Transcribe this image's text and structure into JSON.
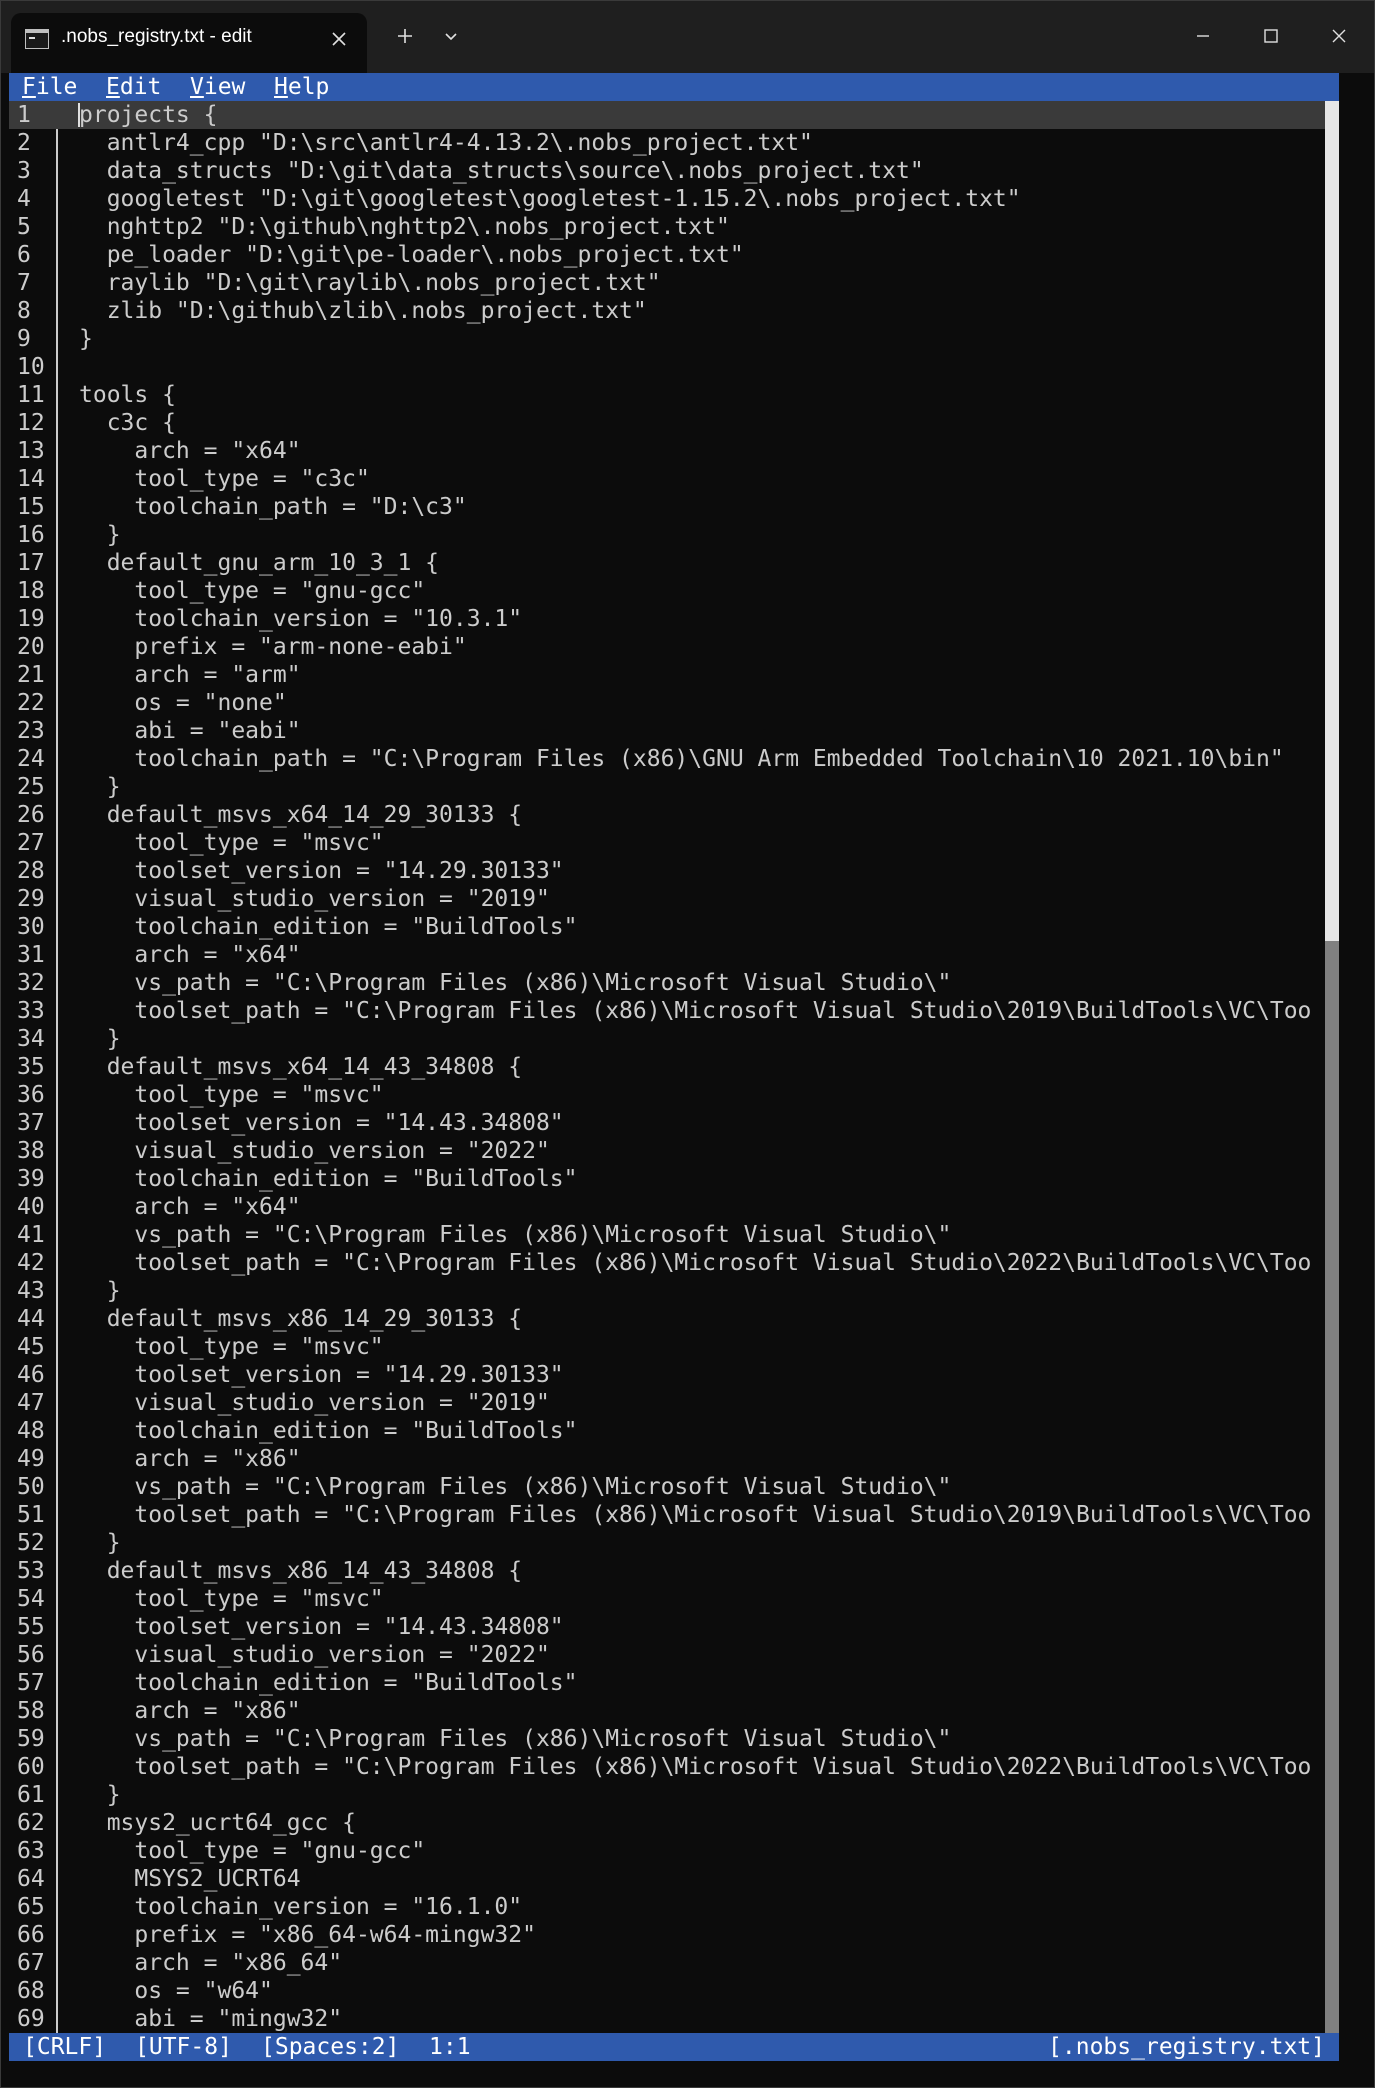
{
  "tab": {
    "title": ".nobs_registry.txt - edit"
  },
  "menu": {
    "file": "File",
    "edit": "Edit",
    "view": "View",
    "help": "Help"
  },
  "editor": {
    "current_line": 1,
    "lines": [
      "projects {",
      "  antlr4_cpp \"D:\\src\\antlr4-4.13.2\\.nobs_project.txt\"",
      "  data_structs \"D:\\git\\data_structs\\source\\.nobs_project.txt\"",
      "  googletest \"D:\\git\\googletest\\googletest-1.15.2\\.nobs_project.txt\"",
      "  nghttp2 \"D:\\github\\nghttp2\\.nobs_project.txt\"",
      "  pe_loader \"D:\\git\\pe-loader\\.nobs_project.txt\"",
      "  raylib \"D:\\git\\raylib\\.nobs_project.txt\"",
      "  zlib \"D:\\github\\zlib\\.nobs_project.txt\"",
      "}",
      "",
      "tools {",
      "  c3c {",
      "    arch = \"x64\"",
      "    tool_type = \"c3c\"",
      "    toolchain_path = \"D:\\c3\"",
      "  }",
      "  default_gnu_arm_10_3_1 {",
      "    tool_type = \"gnu-gcc\"",
      "    toolchain_version = \"10.3.1\"",
      "    prefix = \"arm-none-eabi\"",
      "    arch = \"arm\"",
      "    os = \"none\"",
      "    abi = \"eabi\"",
      "    toolchain_path = \"C:\\Program Files (x86)\\GNU Arm Embedded Toolchain\\10 2021.10\\bin\"",
      "  }",
      "  default_msvs_x64_14_29_30133 {",
      "    tool_type = \"msvc\"",
      "    toolset_version = \"14.29.30133\"",
      "    visual_studio_version = \"2019\"",
      "    toolchain_edition = \"BuildTools\"",
      "    arch = \"x64\"",
      "    vs_path = \"C:\\Program Files (x86)\\Microsoft Visual Studio\\\"",
      "    toolset_path = \"C:\\Program Files (x86)\\Microsoft Visual Studio\\2019\\BuildTools\\VC\\Too",
      "  }",
      "  default_msvs_x64_14_43_34808 {",
      "    tool_type = \"msvc\"",
      "    toolset_version = \"14.43.34808\"",
      "    visual_studio_version = \"2022\"",
      "    toolchain_edition = \"BuildTools\"",
      "    arch = \"x64\"",
      "    vs_path = \"C:\\Program Files (x86)\\Microsoft Visual Studio\\\"",
      "    toolset_path = \"C:\\Program Files (x86)\\Microsoft Visual Studio\\2022\\BuildTools\\VC\\Too",
      "  }",
      "  default_msvs_x86_14_29_30133 {",
      "    tool_type = \"msvc\"",
      "    toolset_version = \"14.29.30133\"",
      "    visual_studio_version = \"2019\"",
      "    toolchain_edition = \"BuildTools\"",
      "    arch = \"x86\"",
      "    vs_path = \"C:\\Program Files (x86)\\Microsoft Visual Studio\\\"",
      "    toolset_path = \"C:\\Program Files (x86)\\Microsoft Visual Studio\\2019\\BuildTools\\VC\\Too",
      "  }",
      "  default_msvs_x86_14_43_34808 {",
      "    tool_type = \"msvc\"",
      "    toolset_version = \"14.43.34808\"",
      "    visual_studio_version = \"2022\"",
      "    toolchain_edition = \"BuildTools\"",
      "    arch = \"x86\"",
      "    vs_path = \"C:\\Program Files (x86)\\Microsoft Visual Studio\\\"",
      "    toolset_path = \"C:\\Program Files (x86)\\Microsoft Visual Studio\\2022\\BuildTools\\VC\\Too",
      "  }",
      "  msys2_ucrt64_gcc {",
      "    tool_type = \"gnu-gcc\"",
      "    MSYS2_UCRT64",
      "    toolchain_version = \"16.1.0\"",
      "    prefix = \"x86_64-w64-mingw32\"",
      "    arch = \"x86_64\"",
      "    os = \"w64\"",
      "    abi = \"mingw32\""
    ]
  },
  "status": {
    "line_ending": "[CRLF]",
    "encoding": "[UTF-8]",
    "indentation": "[Spaces:2]",
    "position": "1:1",
    "filename": "[.nobs_registry.txt]"
  },
  "colors": {
    "bar_blue": "#2f5aad",
    "editor_bg": "#0c0c0c",
    "text": "#cccccc",
    "current_line": "#3a3a3a"
  },
  "icons": {
    "tab": "terminal-icon",
    "tab_close": "close-icon",
    "new_tab": "plus-icon",
    "tab_dropdown": "chevron-down-icon",
    "minimize": "minimize-icon",
    "maximize": "maximize-icon",
    "close": "close-icon"
  }
}
